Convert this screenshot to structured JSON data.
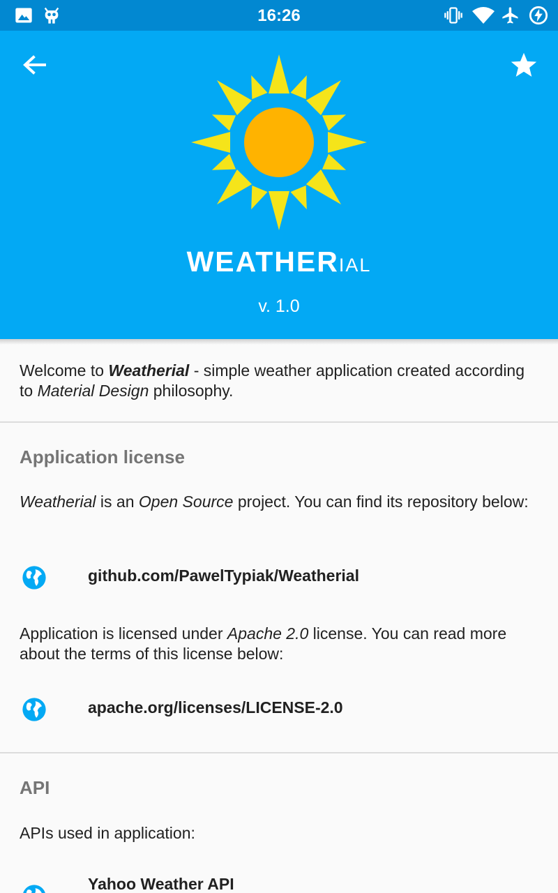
{
  "status_bar": {
    "time": "16:26",
    "left_icons": [
      "image-icon",
      "cyanogen-mascot-icon"
    ],
    "right_icons": [
      "vibrate-icon",
      "wifi-icon",
      "airplane-icon",
      "battery-charging-icon"
    ]
  },
  "header": {
    "logo_main": "WEATHER",
    "logo_tail": "IAL",
    "version": "v. 1.0",
    "colors": {
      "background": "#03a9f4",
      "status": "#0288d1",
      "sun_rays": "#f5e41a",
      "sun_core": "#ffb300"
    }
  },
  "welcome": {
    "t1": "Welcome to ",
    "t2": "Weatherial",
    "t3": " - simple weather application created according to ",
    "t4": "Material Design",
    "t5": " philosophy."
  },
  "license": {
    "title": "Application license",
    "p1_a": "Weatherial",
    "p1_b": " is an ",
    "p1_c": "Open Source",
    "p1_d": " project. You can find its repository below:",
    "link1": "github.com/PawelTypiak/Weatherial",
    "p2_a": "Application is licensed under ",
    "p2_b": "Apache 2.0",
    "p2_c": " license. You can read more about the terms of this license below:",
    "link2": "apache.org/licenses/LICENSE-2.0"
  },
  "api": {
    "title": "API",
    "p1": "APIs used in application:",
    "link1": "Yahoo Weather API"
  }
}
